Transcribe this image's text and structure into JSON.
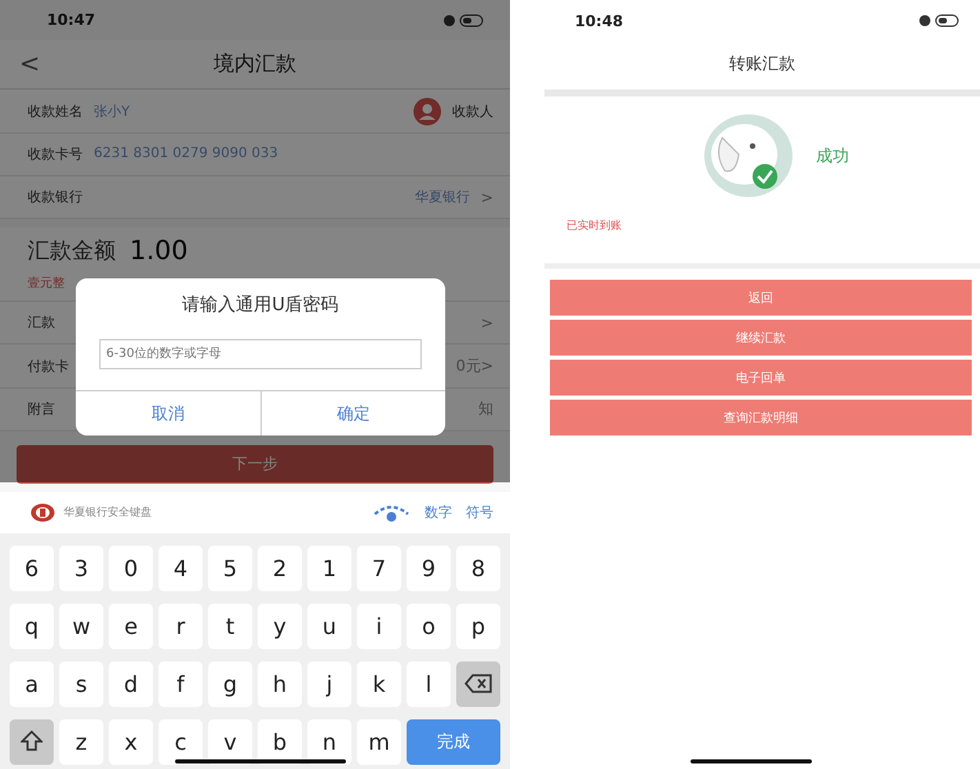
{
  "left_screen": {
    "status_time": "10:47",
    "back": "<",
    "title": "境内汇款",
    "rows": [
      {
        "label": "收款姓名",
        "value": "张小Y",
        "trail": "收款人",
        "kind": "payee"
      },
      {
        "label": "收款卡号",
        "value": "6231 8301 0279 9090 033",
        "kind": "plain"
      },
      {
        "label": "收款银行",
        "value": "华夏银行",
        "trail": ">",
        "kind": "select"
      }
    ],
    "amount": {
      "label": "汇款金额",
      "value": "1.00",
      "note": "壹元整"
    },
    "covered_rows": [
      {
        "label": "汇款",
        "trail": ">"
      },
      {
        "label": "付款卡",
        "trail": "0元>"
      },
      {
        "label": "附言",
        "trail": "知"
      }
    ],
    "next_button": "下一步",
    "dialog": {
      "title": "请输入通用U盾密码",
      "placeholder": "6-30位的数字或字母",
      "buttons": [
        "取消",
        "确定"
      ]
    },
    "keyboard": {
      "title": "华夏银行安全键盘",
      "modes": [
        "数字",
        "符号"
      ],
      "rows": [
        [
          {
            "kind": "char",
            "label": "6"
          },
          {
            "kind": "char",
            "label": "3"
          },
          {
            "kind": "char",
            "label": "0"
          },
          {
            "kind": "char",
            "label": "4"
          },
          {
            "kind": "char",
            "label": "5"
          },
          {
            "kind": "char",
            "label": "2"
          },
          {
            "kind": "char",
            "label": "1"
          },
          {
            "kind": "char",
            "label": "7"
          },
          {
            "kind": "char",
            "label": "9"
          },
          {
            "kind": "char",
            "label": "8"
          }
        ],
        [
          {
            "kind": "char",
            "label": "q"
          },
          {
            "kind": "char",
            "label": "w"
          },
          {
            "kind": "char",
            "label": "e"
          },
          {
            "kind": "char",
            "label": "r"
          },
          {
            "kind": "char",
            "label": "t"
          },
          {
            "kind": "char",
            "label": "y"
          },
          {
            "kind": "char",
            "label": "u"
          },
          {
            "kind": "char",
            "label": "i"
          },
          {
            "kind": "char",
            "label": "o"
          },
          {
            "kind": "char",
            "label": "p"
          }
        ],
        [
          {
            "kind": "char",
            "label": "a"
          },
          {
            "kind": "char",
            "label": "s"
          },
          {
            "kind": "char",
            "label": "d"
          },
          {
            "kind": "char",
            "label": "f"
          },
          {
            "kind": "char",
            "label": "g"
          },
          {
            "kind": "char",
            "label": "h"
          },
          {
            "kind": "char",
            "label": "j"
          },
          {
            "kind": "char",
            "label": "k"
          },
          {
            "kind": "char",
            "label": "l"
          },
          {
            "kind": "backspace"
          }
        ],
        [
          {
            "kind": "shift"
          },
          {
            "kind": "char",
            "label": "z"
          },
          {
            "kind": "char",
            "label": "x"
          },
          {
            "kind": "char",
            "label": "c"
          },
          {
            "kind": "char",
            "label": "v"
          },
          {
            "kind": "char",
            "label": "b"
          },
          {
            "kind": "char",
            "label": "n"
          },
          {
            "kind": "char",
            "label": "m"
          },
          {
            "kind": "done",
            "label": "完成"
          }
        ]
      ]
    }
  },
  "right_screen": {
    "status_time": "10:48",
    "title": "转账汇款",
    "result": "成功",
    "note": "已实时到账",
    "buttons": [
      "返回",
      "继续汇款",
      "电子回单",
      "查询汇款明细"
    ]
  }
}
